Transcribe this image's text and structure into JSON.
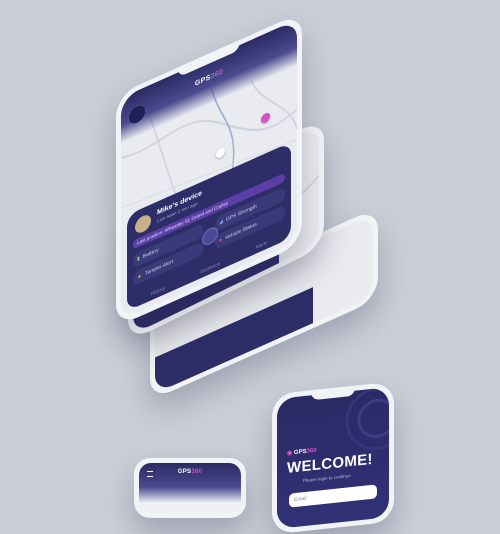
{
  "brand": {
    "prefix": "GPS",
    "suffix": "360",
    "full": "GPS360"
  },
  "device_card": {
    "name": "Mike's device",
    "subtitle": "Last seen 2 min ago",
    "status": "Last position: Wheatley St, Grand and Copley",
    "tiles": [
      {
        "label": "Battery",
        "icon": "battery-icon"
      },
      {
        "label": "GPS Strength",
        "icon": "signal-icon"
      },
      {
        "label": "Tamper Alert",
        "icon": "alert-icon"
      },
      {
        "label": "Vehicle Status",
        "icon": "car-icon"
      }
    ],
    "nav": [
      "History",
      "Geofence",
      "Alerts"
    ]
  },
  "welcome": {
    "title": "WELCOME!",
    "subtitle": "Please login to continue",
    "email_placeholder": "Email"
  },
  "colors": {
    "navy": "#2c2c66",
    "accent": "#d84fc7",
    "purple": "#5b3fa6",
    "background": "#c9ced7"
  }
}
